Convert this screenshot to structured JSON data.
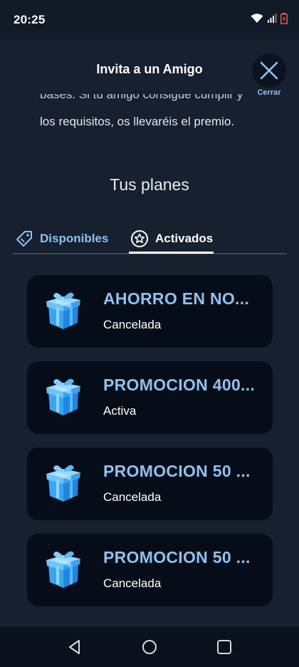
{
  "status_bar": {
    "time": "20:25"
  },
  "header": {
    "title": "Invita a un Amigo",
    "close_label": "Cerrar",
    "desc_line1": "los requisitos, os llevaréis el premio.",
    "desc_faded": "bases. Si tu amigo consigue cumplir y cumple"
  },
  "section": {
    "title": "Tus planes"
  },
  "tabs": [
    {
      "label": "Disponibles",
      "icon": "tag-icon",
      "active": false
    },
    {
      "label": "Activados",
      "icon": "star-badge-icon",
      "active": true
    }
  ],
  "plans": [
    {
      "title": "AHORRO EN NO...",
      "status": "Cancelada",
      "icon": "gift-icon"
    },
    {
      "title": "PROMOCION 400...",
      "status": "Activa",
      "icon": "gift-icon"
    },
    {
      "title": "PROMOCION 50 ...",
      "status": "Cancelada",
      "icon": "gift-icon"
    },
    {
      "title": "PROMOCION 50 ...",
      "status": "Cancelada",
      "icon": "gift-icon"
    }
  ],
  "colors": {
    "accent": "#8fc1ef",
    "background": "#16202f",
    "card": "#070d18"
  }
}
